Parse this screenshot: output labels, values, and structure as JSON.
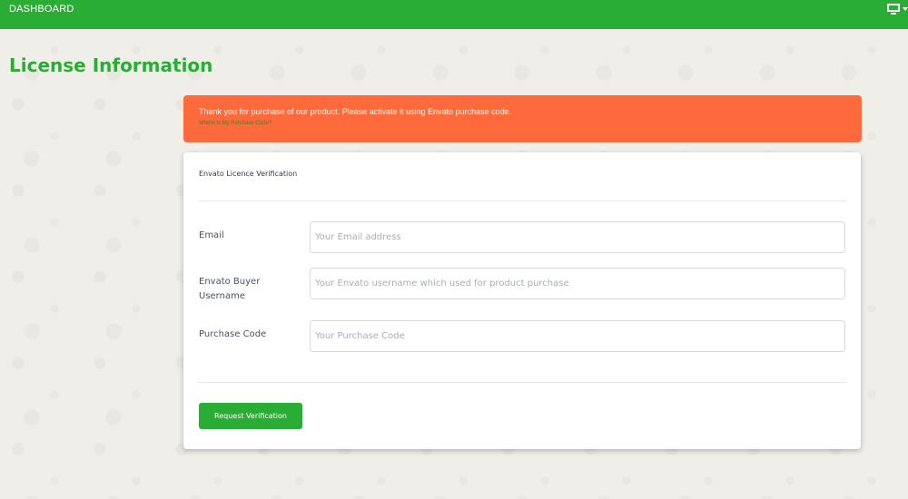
{
  "topbar": {
    "brand": "DASHBOARD",
    "right_icon": "monitor-icon",
    "accent": "#2aad34"
  },
  "page": {
    "title": "License Information"
  },
  "alert": {
    "message": "Thank you for purchase of our product. Please activate it using Envato purchase code.",
    "link": "Where Is My Purchase Code?",
    "color": "#ff6a3d"
  },
  "card": {
    "header": "Envato Licence Verification",
    "fields": [
      {
        "label": "Email",
        "placeholder": "Your Email address",
        "value": ""
      },
      {
        "label": "Envato Buyer Username",
        "placeholder": "Your Envato username which used for product purchase",
        "value": ""
      },
      {
        "label": "Purchase Code",
        "placeholder": "Your Purchase Code",
        "value": ""
      }
    ],
    "submit_label": "Request Verification"
  }
}
